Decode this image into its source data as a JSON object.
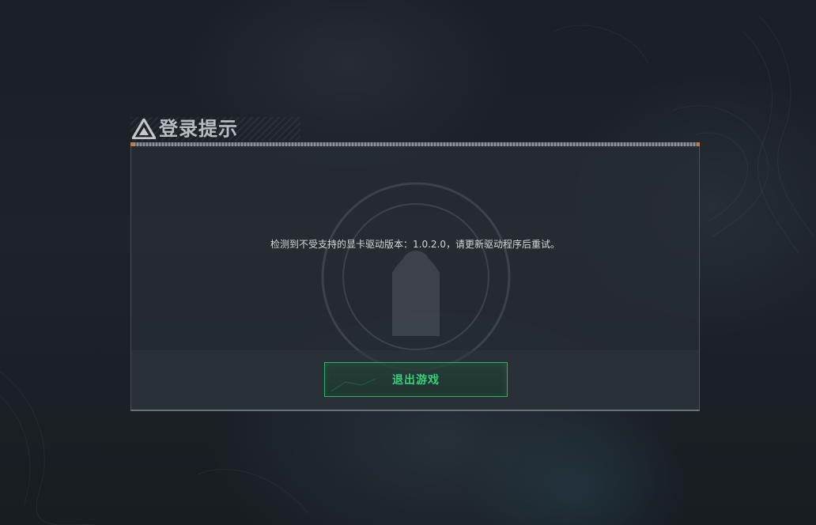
{
  "dialog": {
    "title": "登录提示",
    "title_icon": "warning-triangle-icon",
    "message": "检测到不受支持的显卡驱动版本：1.0.2.0，请更新驱动程序后重试。",
    "exit_button_label": "退出游戏"
  },
  "colors": {
    "accent_green": "#35d27a",
    "button_border": "#2fb36b",
    "title_text": "#b8bdc2",
    "title_line_cap": "#c9763a"
  }
}
